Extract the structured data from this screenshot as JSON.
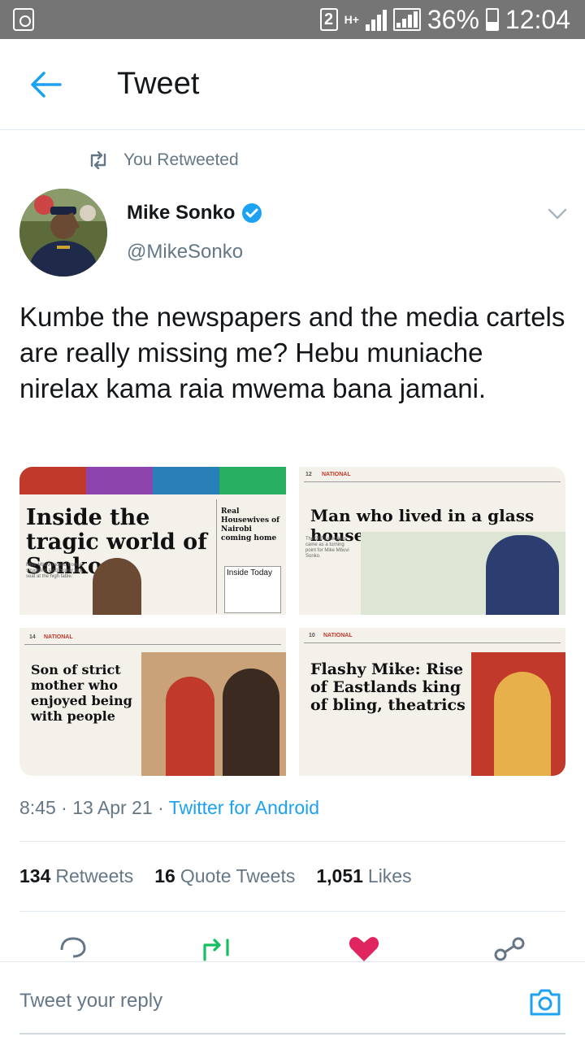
{
  "status_bar": {
    "sim": "2",
    "network": "H+",
    "battery": "36%",
    "time": "12:04"
  },
  "header": {
    "title": "Tweet"
  },
  "context": {
    "retweet_label": "You Retweeted"
  },
  "tweet": {
    "display_name": "Mike Sonko",
    "handle": "@MikeSonko",
    "text": "Kumbe the newspapers and the media cartels are really missing me? Hebu muniache nirelax kama raia mwema bana jamani.",
    "timestamp": "8:45 · 13 Apr 21 · ",
    "source": "Twitter for Android"
  },
  "media": [
    {
      "headline": "Inside the tragic world of Sonko",
      "sidebar_headline": "Real Housewives of Nairobi coming home",
      "sidebar_box": "Inside Today"
    },
    {
      "page": "12",
      "section": "NATIONAL",
      "headline": "Man who lived in a glass house"
    },
    {
      "page": "14",
      "section": "NATIONAL",
      "headline": "Son of strict mother who enjoyed being with people"
    },
    {
      "page": "10",
      "section": "NATIONAL",
      "headline": "Flashy Mike: Rise of Eastlands king of bling, theatrics"
    }
  ],
  "stats": {
    "retweets_count": "134",
    "retweets_label": "Retweets",
    "quotes_count": "16",
    "quotes_label": "Quote Tweets",
    "likes_count": "1,051",
    "likes_label": "Likes"
  },
  "reply": {
    "placeholder": "Tweet your reply"
  },
  "colors": {
    "accent": "#1da1f2",
    "retweet_green": "#17bf63",
    "like_red": "#e0245e",
    "secondary_text": "#657786",
    "status_bar": "#757575"
  },
  "icons": {
    "back": "back-arrow-icon",
    "verified": "verified-badge-icon",
    "caret": "chevron-down-icon",
    "reply": "reply-icon",
    "retweet": "retweet-icon",
    "like": "heart-icon",
    "share": "share-icon",
    "camera": "camera-icon"
  }
}
